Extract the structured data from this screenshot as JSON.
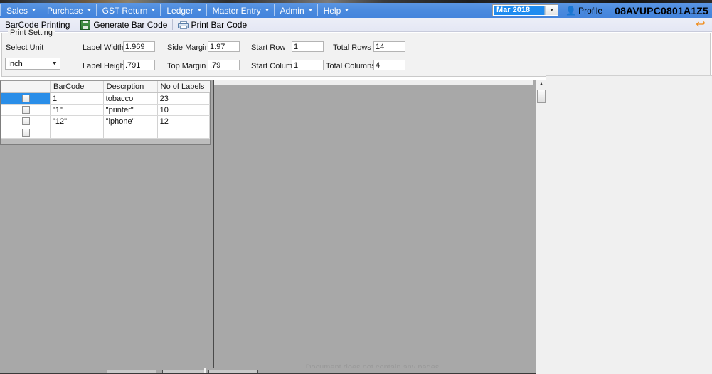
{
  "menu": {
    "items": [
      {
        "label": "Sales"
      },
      {
        "label": "Purchase"
      },
      {
        "label": "GST Return"
      },
      {
        "label": "Ledger"
      },
      {
        "label": "Master Entry"
      },
      {
        "label": "Admin"
      },
      {
        "label": "Help"
      }
    ],
    "caret": "▼",
    "period": "Mar 2018",
    "period_arrow": "▼",
    "profile_label": "Profile",
    "profile_icon": "👤",
    "gstin": "08AVUPC0801A1Z5"
  },
  "toolstrip": {
    "title": "BarCode Printing",
    "generate_label": "Generate Bar Code",
    "print_label": "Print Bar Code",
    "undo_glyph": "↩"
  },
  "print_setting": {
    "legend": "Print Setting",
    "select_unit_label": "Select Unit",
    "unit_value": "Inch",
    "unit_arrow": "▼",
    "fields": [
      {
        "label": "Label Width",
        "value": "1.969"
      },
      {
        "label": "Label Height",
        "value": ".791"
      },
      {
        "label": "Side Margin",
        "value": "1.97"
      },
      {
        "label": "Top Margin",
        "value": ".79"
      },
      {
        "label": "Start Row",
        "value": "1"
      },
      {
        "label": "Start Column",
        "value": "1"
      },
      {
        "label": "Total Rows",
        "value": "14"
      },
      {
        "label": "Total Columns",
        "value": "4"
      }
    ]
  },
  "grid": {
    "columns": [
      "",
      "BarCode",
      "Descrption",
      "No of Labels"
    ],
    "rows": [
      {
        "barcode": "1",
        "description": "tobacco",
        "labels": "23",
        "selected": true
      },
      {
        "barcode": "\"1\"",
        "description": "\"printer\"",
        "labels": "10",
        "selected": false
      },
      {
        "barcode": "\"12\"",
        "description": "\"iphone\"",
        "labels": "12",
        "selected": false
      },
      {
        "barcode": "",
        "description": "",
        "labels": "",
        "selected": false
      }
    ]
  },
  "preview": {
    "empty_message": "Document does not contain any pages.",
    "scroll_up_glyph": "▲"
  },
  "colors": {
    "menu_blue": "#4a8ade",
    "accent_blue": "#2a8ee8",
    "ribbon": "#e7eaf6",
    "preview_gray": "#a8a8a8",
    "panel_gray": "#f0f0f0",
    "undo_orange": "#f08c1a"
  }
}
